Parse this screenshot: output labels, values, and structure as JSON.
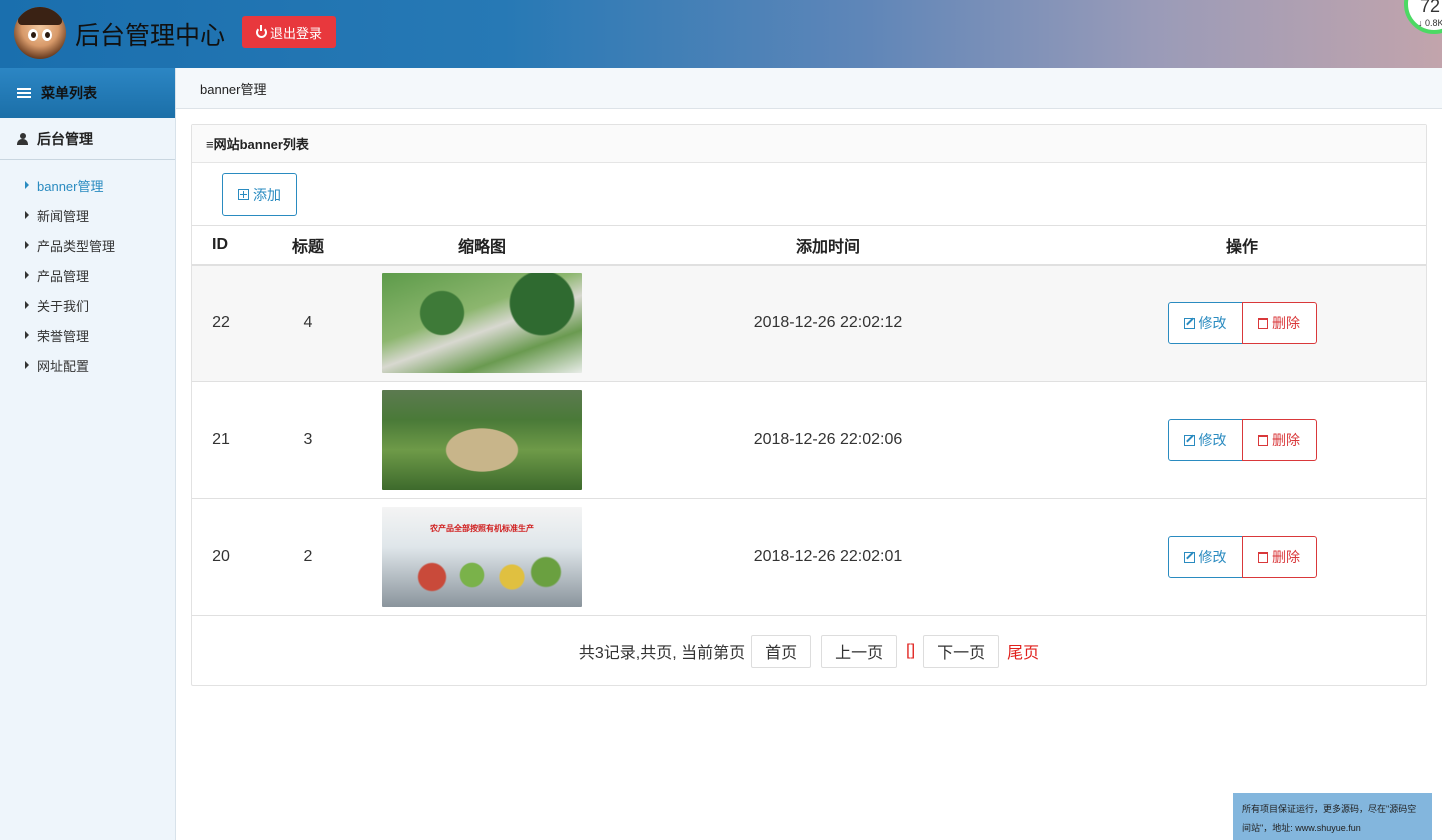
{
  "header": {
    "title": "后台管理中心",
    "logout_label": "退出登录",
    "speed_value": "72",
    "speed_rate": "↓ 0.8K"
  },
  "sidebar": {
    "menu_title": "菜单列表",
    "section_title": "后台管理",
    "items": [
      {
        "label": "banner管理",
        "active": true
      },
      {
        "label": "新闻管理",
        "active": false
      },
      {
        "label": "产品类型管理",
        "active": false
      },
      {
        "label": "产品管理",
        "active": false
      },
      {
        "label": "关于我们",
        "active": false
      },
      {
        "label": "荣誉管理",
        "active": false
      },
      {
        "label": "网址配置",
        "active": false
      }
    ]
  },
  "breadcrumb": "banner管理",
  "panel": {
    "title": "≡网站banner列表",
    "add_label": "添加"
  },
  "table": {
    "headers": {
      "id": "ID",
      "title": "标题",
      "thumb": "缩略图",
      "time": "添加时间",
      "ops": "操作"
    },
    "rows": [
      {
        "id": "22",
        "title": "4",
        "thumb_text": "",
        "time": "2018-12-26 22:02:12",
        "edit": "修改",
        "delete": "删除"
      },
      {
        "id": "21",
        "title": "3",
        "thumb_text": "",
        "time": "2018-12-26 22:02:06",
        "edit": "修改",
        "delete": "删除"
      },
      {
        "id": "20",
        "title": "2",
        "thumb_text": "农产品全部按照有机标准生产",
        "time": "2018-12-26 22:02:01",
        "edit": "修改",
        "delete": "删除"
      }
    ]
  },
  "pager": {
    "info": "共3记录,共页, 当前第页",
    "first": "首页",
    "prev": "上一页",
    "current": "[]",
    "next": "下一页",
    "last": "尾页"
  },
  "footer_note": "所有项目保证运行，更多源码，尽在\"源码空间站\"，地址: www.shuyue.fun",
  "colors": {
    "accent": "#2a8bc0",
    "danger": "#e8383d",
    "sidebar_bg": "#eef5fb"
  }
}
